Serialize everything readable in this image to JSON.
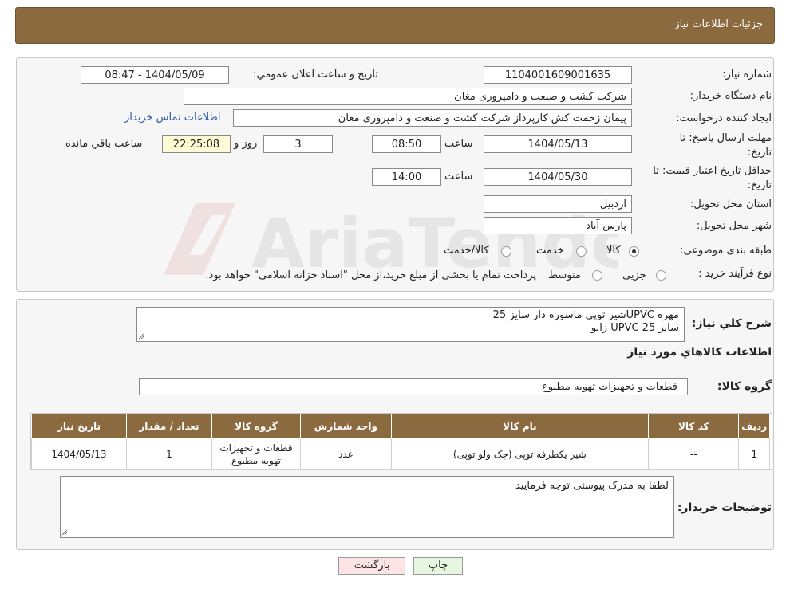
{
  "header": {
    "title": "جزئیات اطلاعات نیاز"
  },
  "watermark": {
    "text": "AriaTender.neT"
  },
  "form": {
    "need_number_label": "شماره نیاز:",
    "need_number": "1104001609001635",
    "announce_label": "تاریخ و ساعت اعلان عمومي:",
    "announce_value": "1404/05/09 - 08:47",
    "buyer_org_label": "نام دستگاه خریدار:",
    "buyer_org": "شرکت کشت و صنعت و دامپروری مغان",
    "requester_label": "ایجاد کننده درخواست:",
    "requester": "پیمان زحمت کش کارپرداز شرکت کشت و صنعت و دامپروری مغان",
    "contact_link": "اطلاعات تماس خریدار",
    "deadline_label_1": "مهلت ارسال پاسخ: تا",
    "deadline_label_2": "تاریخ:",
    "deadline_date": "1404/05/13",
    "time_label": "ساعت",
    "deadline_time": "08:50",
    "days_value": "3",
    "days_label": "روز و",
    "remaining_time": "22:25:08",
    "remaining_label": "ساعت باقي مانده",
    "validity_label_1": "حداقل تاریخ اعتبار قیمت: تا",
    "validity_label_2": "تاریخ:",
    "validity_date": "1404/05/30",
    "validity_time": "14:00",
    "province_label": "استان محل تحویل:",
    "province": "اردبیل",
    "city_label": "شهر محل تحویل:",
    "city": "پارس آباد",
    "category_label": "طبقه بندی موضوعی:",
    "category_options": [
      "کالا",
      "خدمت",
      "کالا/خدمت"
    ],
    "category_selected": "کالا",
    "process_label": "نوع فرآیند خرید :",
    "process_options": [
      "جزیی",
      "متوسط"
    ],
    "process_note": "پرداخت تمام یا بخشی از مبلغ خرید،از محل \"اسناد خزانه اسلامی\" خواهد بود."
  },
  "summary": {
    "desc_label": "شرح کلي نياز:",
    "desc_line1": "مهره UPVCشیر توپی ماسوره دار سایز 25",
    "desc_line2": "سایز UPVC 25 زانو",
    "goods_info_title": "اطلاعات کالاهاي مورد نياز",
    "group_label": "گروه کالا:",
    "group_value": "قطعات و تجهیزات تهویه مطبوع",
    "table": {
      "headers": [
        "ردیف",
        "کد کالا",
        "نام کالا",
        "واحد شمارش",
        "گروه کالا",
        "تعداد / مقدار",
        "تاریخ نیاز"
      ],
      "rows": [
        {
          "row": "1",
          "code": "--",
          "name": "شیر یکطرفه توپی (چک ولو توپی)",
          "unit": "عدد",
          "group_line1": "قطعات و تجهیزات",
          "group_line2": "تهویه مطبوع",
          "qty": "1",
          "date": "1404/05/13"
        }
      ]
    },
    "buyer_notes_label": "توضیحات خریدار:",
    "buyer_notes": "لطفا به مدرک پیوستی توجه فرمایید"
  },
  "buttons": {
    "print": "چاپ",
    "back": "بازگشت"
  },
  "colors": {
    "header_bg": "#8b6a3f",
    "back_button_bg": "#fde4e4",
    "print_button_bg": "#e6f6e0",
    "remaining_bg": "#fffbd4"
  }
}
